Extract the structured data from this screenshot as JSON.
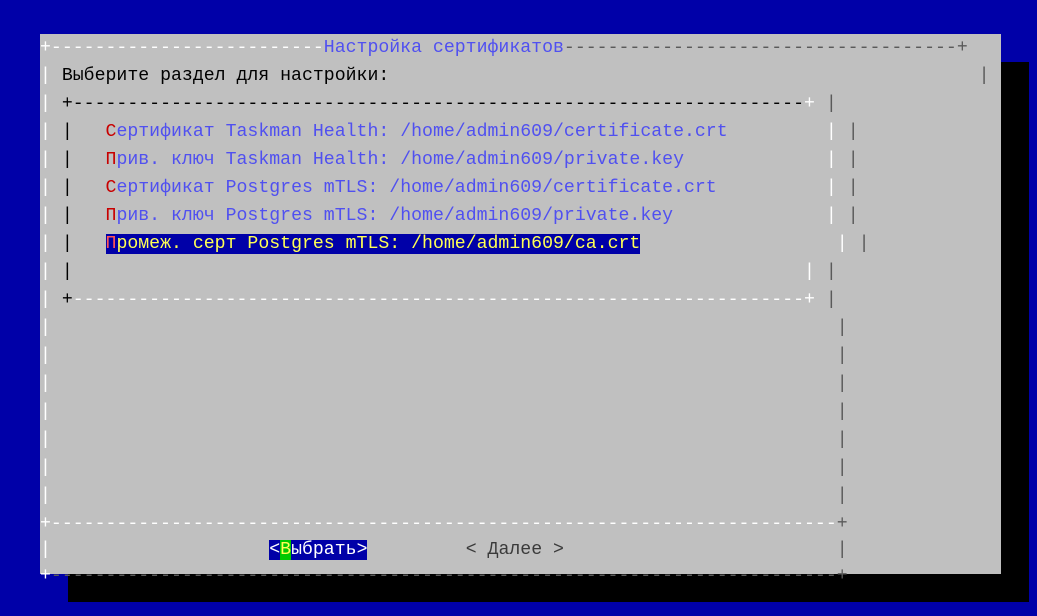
{
  "dialog": {
    "title": "Настройка сертификатов",
    "prompt": "Выберите раздел для настройки:"
  },
  "menu": {
    "items": [
      {
        "hotkey": "С",
        "rest": "ертификат Taskman Health: /home/admin609/certificate.crt"
      },
      {
        "hotkey": "П",
        "rest": "рив. ключ Taskman Health: /home/admin609/private.key"
      },
      {
        "hotkey": "С",
        "rest": "ертификат Postgres mTLS: /home/admin609/certificate.crt"
      },
      {
        "hotkey": "П",
        "rest": "рив. ключ Postgres mTLS: /home/admin609/private.key"
      },
      {
        "hotkey": "П",
        "rest": "ромеж. серт Postgres mTLS: /home/admin609/ca.crt"
      }
    ],
    "selected_index": 4
  },
  "buttons": {
    "select": {
      "open": "<",
      "hotkey": "В",
      "rest": "ыбрать",
      "close": ">"
    },
    "next": "< Далее >"
  },
  "colors": {
    "screen_bg": "#0000a8",
    "dialog_bg": "#c0c0c0",
    "item_text": "#5050f0",
    "hotkey": "#c80000",
    "selection_bg": "#0000a8",
    "selection_text": "#ffff54",
    "button_hotkey_bg": "#00c800"
  }
}
